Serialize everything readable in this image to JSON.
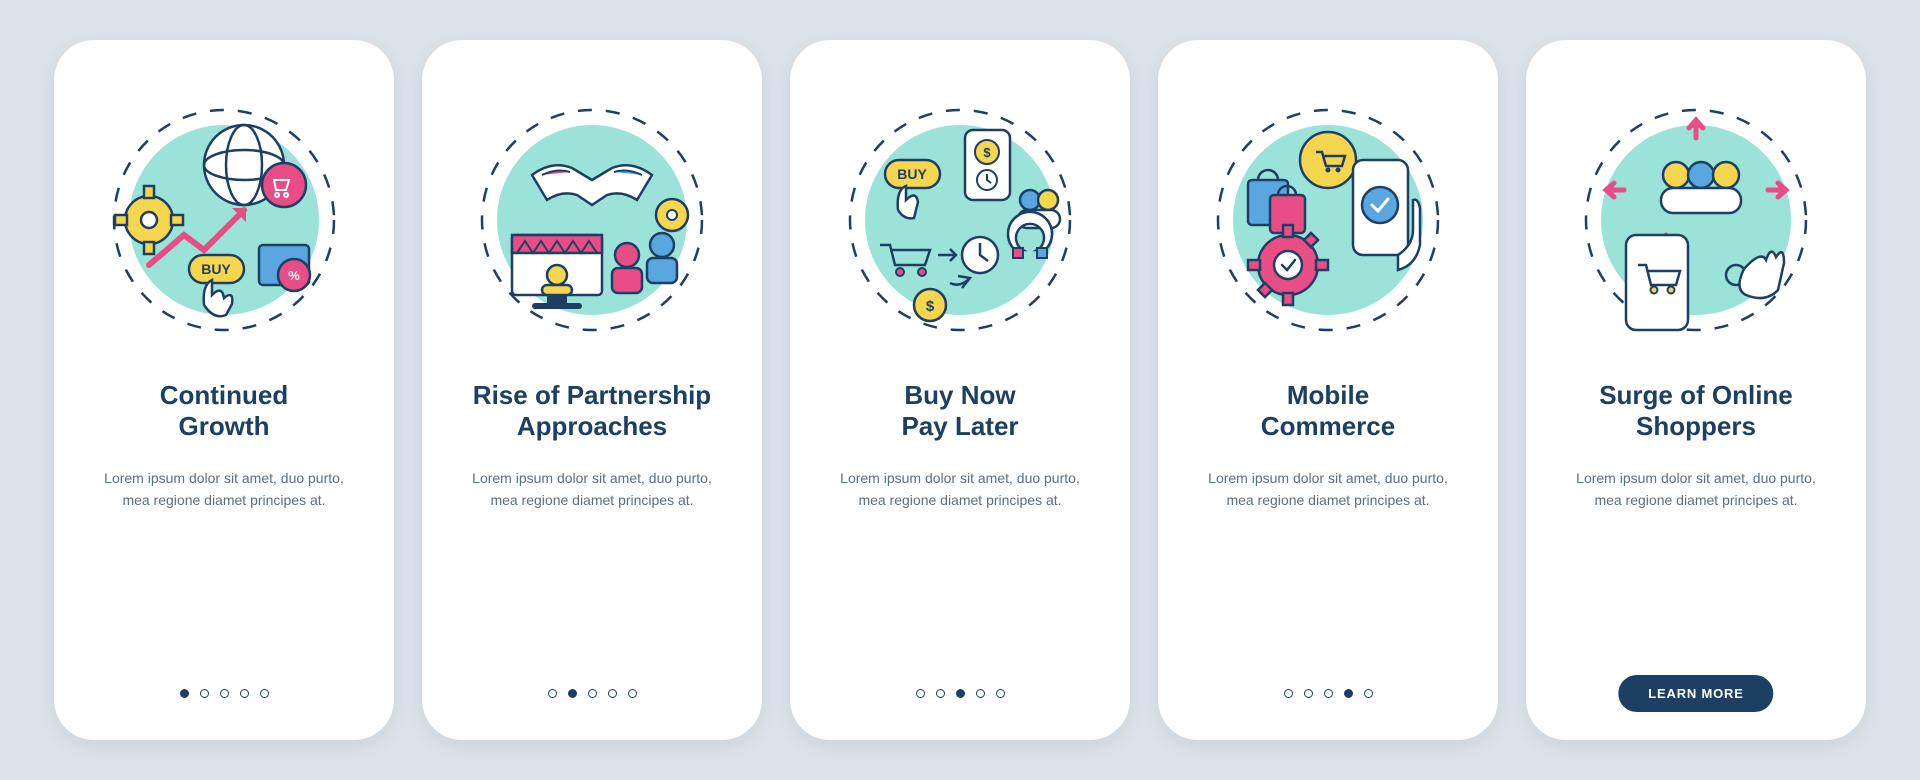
{
  "colors": {
    "navy": "#1d3f63",
    "teal": "#9be3d9",
    "pink": "#e84d85",
    "yellow": "#f5d64e",
    "blue": "#5aa6e0",
    "text": "#5b6f82"
  },
  "cta_label": "LEARN MORE",
  "total_slides": 5,
  "body_text": "Lorem ipsum dolor sit amet, duo purto, mea regione diamet principes at.",
  "slides": [
    {
      "title": "Continued\nGrowth",
      "desc": "Lorem ipsum dolor sit amet, duo purto, mea regione diamet principes at.",
      "active_index": 0,
      "has_cta": false,
      "icon": "growth"
    },
    {
      "title": "Rise of Partnership\nApproaches",
      "desc": "Lorem ipsum dolor sit amet, duo purto, mea regione diamet principes at.",
      "active_index": 1,
      "has_cta": false,
      "icon": "partnership"
    },
    {
      "title": "Buy Now\nPay Later",
      "desc": "Lorem ipsum dolor sit amet, duo purto, mea regione diamet principes at.",
      "active_index": 2,
      "has_cta": false,
      "icon": "bnpl"
    },
    {
      "title": "Mobile\nCommerce",
      "desc": "Lorem ipsum dolor sit amet, duo purto, mea regione diamet principes at.",
      "active_index": 3,
      "has_cta": false,
      "icon": "mobile"
    },
    {
      "title": "Surge of Online\nShoppers",
      "desc": "Lorem ipsum dolor sit amet, duo purto, mea regione diamet principes at.",
      "active_index": 4,
      "has_cta": true,
      "icon": "shoppers"
    }
  ]
}
